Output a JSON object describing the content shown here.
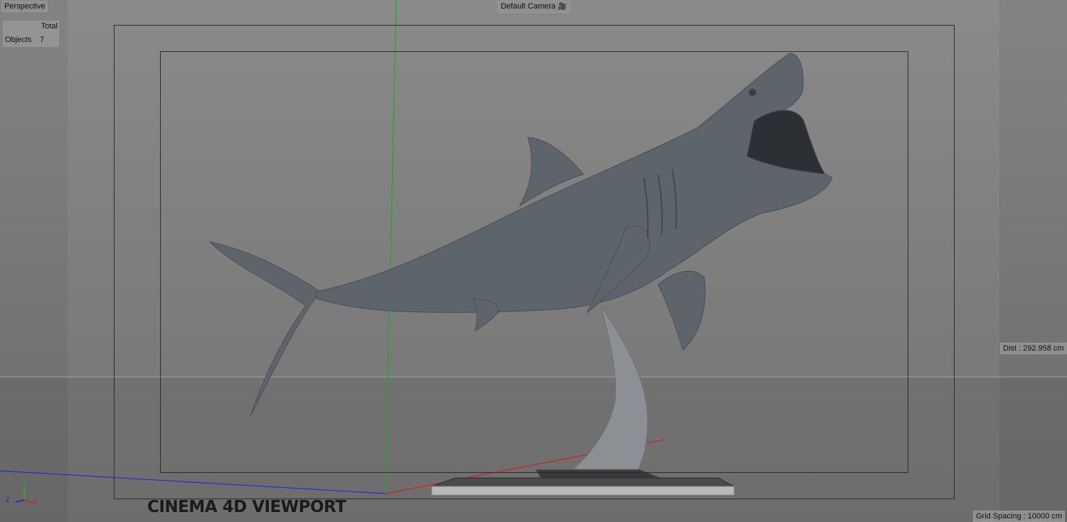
{
  "viewport": {
    "view_name": "Perspective",
    "camera_label": "Default Camera",
    "hud": {
      "header": "Total",
      "objects_label": "Objects",
      "objects_count": "7"
    },
    "distance": "Dist : 292.958 cm",
    "grid_spacing": "Grid Spacing : 10000 cm",
    "axis_labels": {
      "y": "Y",
      "x": "X",
      "z": "Z"
    },
    "footer_label": "CINEMA 4D VIEWPORT"
  },
  "colors": {
    "background": "#7e7e7e",
    "y_axis": "#2db32d",
    "x_axis": "#d02020",
    "z_axis": "#2020c0",
    "model": "#5f656c"
  },
  "icons": {
    "camera": "camera-icon"
  }
}
